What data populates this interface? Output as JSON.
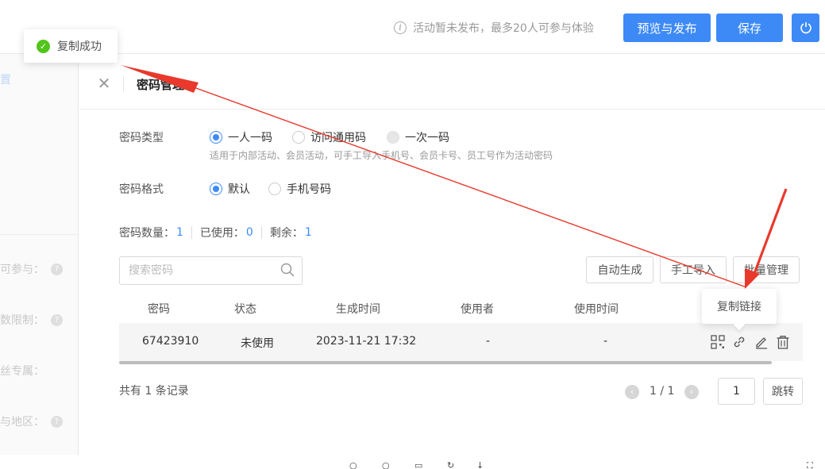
{
  "header": {
    "notice": "活动暂未发布，最多20人可参与体验",
    "publish_label": "预览与发布",
    "save_label": "保存"
  },
  "toast": {
    "text": "复制成功"
  },
  "sidebar": {
    "items": [
      {
        "label": "置"
      },
      {
        "label": "可参与："
      },
      {
        "label": "数限制："
      },
      {
        "label": "丝专属："
      },
      {
        "label": "与地区："
      }
    ]
  },
  "panel": {
    "title": "密码管理",
    "password_type": {
      "label": "密码类型",
      "options": [
        "一人一码",
        "访问通用码",
        "一次一码"
      ],
      "selected": "一人一码",
      "hint": "适用于内部活动、会员活动，可手工导入手机号、会员卡号、员工号作为活动密码"
    },
    "password_format": {
      "label": "密码格式",
      "options": [
        "默认",
        "手机号码"
      ],
      "selected": "默认"
    },
    "counts": {
      "total_label": "密码数量：",
      "total": "1",
      "used_label": "已使用：",
      "used": "0",
      "remain_label": "剩余：",
      "remain": "1"
    },
    "search": {
      "placeholder": "搜索密码",
      "value": ""
    },
    "buttons": {
      "auto_generate": "自动生成",
      "manual_import": "手工导入",
      "batch_manage": "批量管理"
    },
    "table": {
      "columns": [
        "密码",
        "状态",
        "生成时间",
        "使用者",
        "使用时间"
      ],
      "rows": [
        {
          "password": "67423910",
          "status": "未使用",
          "created": "2023-11-21 17:32",
          "user": "-",
          "used_time": "-"
        }
      ]
    },
    "tooltip": "复制链接",
    "footer": {
      "total": "共有 1 条记录",
      "page_text": "1 / 1",
      "page_input": "1",
      "jump_label": "跳转"
    }
  },
  "colors": {
    "primary": "#3d8af7",
    "success": "#52c41a",
    "annotation_arrow": "#e8392c"
  },
  "icons": [
    "info-icon",
    "power-icon",
    "check-icon",
    "close-icon",
    "search-icon",
    "qrcode-icon",
    "link-icon",
    "edit-icon",
    "trash-icon",
    "chevron-left-icon",
    "chevron-right-icon"
  ]
}
